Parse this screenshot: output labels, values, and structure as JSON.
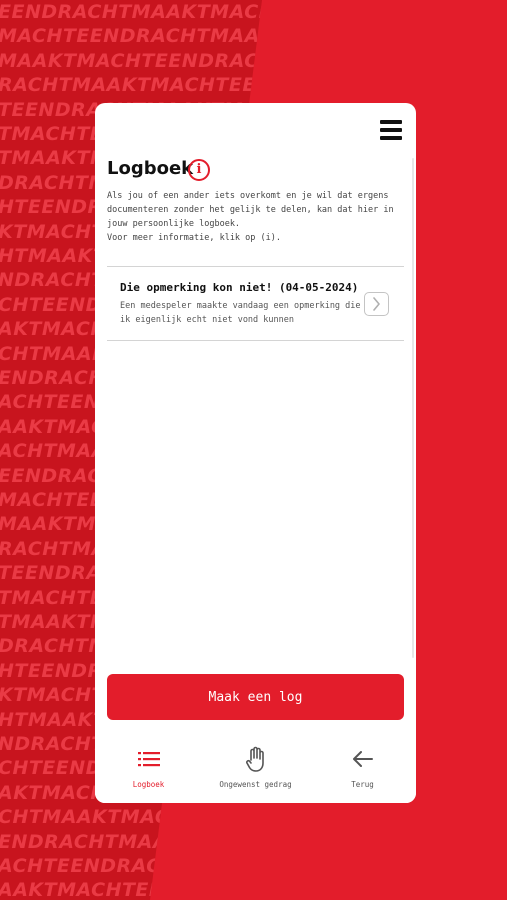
{
  "background": {
    "lines": [
      "EENDRACHTMAAKTMACHTEENDRACHT",
      "MACHTEENDRACHTMAAKTMACHTEEND",
      "MAAKTMACHTEENDRACHTMAAKTMACH",
      "RACHTMAAKTMACHTEENDRACHTMAAK",
      "TEENDRACHTMAAKTMACHTEENDRACH",
      "TMACHTEENDRACHTMAAKTMACHTEEN",
      "TMAAKTMACHTEENDRACHTMAAKTMAC",
      "DRACHTMAAKTMACHTEENDRACHTMAA",
      "HTEENDRACHTMAAKTMACHTEENDRAC",
      "KTMACHTEENDRACHTMAAKTMACHTEE",
      "HTMAAKTMACHTEENDRACHTMAAKTMA",
      "NDRACHTMAAKTMACHTEENDRACHTMA",
      "CHTEENDRACHTMAAKTMACHTEENDRA",
      "AKTMACHTEENDRACHTMAAKTMACHTE",
      "CHTMAAKTMACHTEENDRACHTMAAKTM",
      "ENDRACHTMAAKTMACHTEENDRACHTM",
      "ACHTEENDRACHTMAAKTMACHTEENDR",
      "AAKTMACHTEENDRACHTMAAKTMACHT",
      "ACHTMAAKTMACHTEENDRACHTMAAKT",
      "EENDRACHTMAAKTMACHTEENDRACHT",
      "MACHTEENDRACHTMAAKTMACHTEEND",
      "MAAKTMACHTEENDRACHTMAAKTMACH",
      "RACHTMAAKTMACHTEENDRACHTMAAK",
      "TEENDRACHTMAAKTMACHTEENDRACH",
      "TMACHTEENDRACHTMAAKTMACHTEEN",
      "TMAAKTMACHTEENDRACHTMAAKTMAC",
      "DRACHTMAAKTMACHTEENDRACHTMAA",
      "HTEENDRACHTMAAKTMACHTEENDRAC",
      "KTMACHTEENDRACHTMAAKTMACHTEE",
      "HTMAAKTMACHTEENDRACHTMAAKTMA",
      "NDRACHTMAAKTMACHTEENDRACHTMA",
      "CHTEENDRACHTMAAKTMACHTEENDRA",
      "AKTMACHTEENDRACHTMAAKTMACHTE",
      "CHTMAAKTMACHTEENDRACHTMAAKTM",
      "ENDRACHTMAAKTMACHTEENDRACHTM",
      "ACHTEENDRACHTMAAKTMACHTEENDR",
      "AAKTMACHTEENDRACHTMAAKTMACHT"
    ]
  },
  "header": {
    "title": "Logboek",
    "info_icon_glyph": "i"
  },
  "intro": {
    "paragraph1": "Als jou of een ander iets overkomt en je wil dat ergens documenteren zonder het gelijk te delen, kan dat hier in jouw persoonlijke logboek.",
    "paragraph2": "Voor meer informatie, klik op (i)."
  },
  "entries": [
    {
      "title": "Die opmerking kon niet! (04-05-2024)",
      "description": "Een medespeler maakte vandaag een opmerking die ik eigenlijk echt niet vond kunnen"
    }
  ],
  "actions": {
    "primary_label": "Maak een log"
  },
  "nav": {
    "items": [
      {
        "label": "Logboek",
        "icon": "list-icon",
        "active": true
      },
      {
        "label": "Ongewenst gedrag",
        "icon": "hand-icon",
        "active": false
      },
      {
        "label": "Terug",
        "icon": "arrow-left-icon",
        "active": false
      }
    ]
  },
  "colors": {
    "brand_red": "#e31d2b",
    "dark_red": "#c8141e",
    "text_dark": "#111111",
    "text_muted": "#555555"
  }
}
